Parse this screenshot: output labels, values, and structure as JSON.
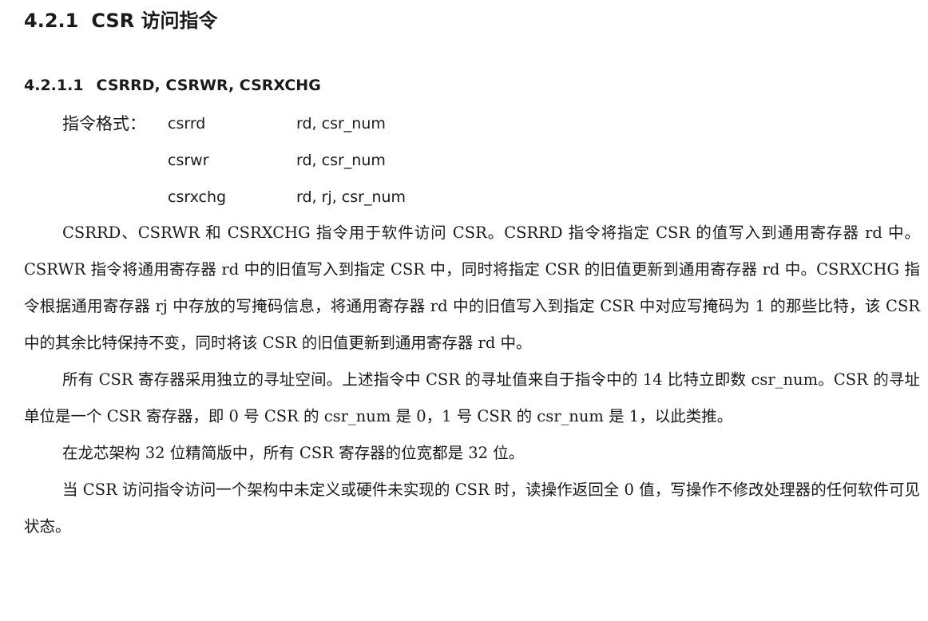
{
  "section": {
    "number": "4.2.1",
    "title": "CSR 访问指令"
  },
  "subsection": {
    "number": "4.2.1.1",
    "title": "CSRRD, CSRWR, CSRXCHG"
  },
  "instruction_format": {
    "label": "指令格式：",
    "rows": [
      {
        "mnemonic": "csrrd",
        "operands": "rd,  csr_num"
      },
      {
        "mnemonic": "csrwr",
        "operands": "rd,  csr_num"
      },
      {
        "mnemonic": "csrxchg",
        "operands": "rd,  rj,  csr_num"
      }
    ]
  },
  "paragraphs": [
    "CSRRD、CSRWR 和 CSRXCHG 指令用于软件访问 CSR。CSRRD 指令将指定 CSR 的值写入到通用寄存器 rd 中。CSRWR 指令将通用寄存器 rd 中的旧值写入到指定 CSR 中，同时将指定 CSR 的旧值更新到通用寄存器 rd 中。CSRXCHG 指令根据通用寄存器 rj 中存放的写掩码信息，将通用寄存器 rd 中的旧值写入到指定 CSR 中对应写掩码为 1 的那些比特，该 CSR 中的其余比特保持不变，同时将该 CSR 的旧值更新到通用寄存器 rd 中。",
    "所有 CSR 寄存器采用独立的寻址空间。上述指令中 CSR 的寻址值来自于指令中的 14 比特立即数 csr_num。CSR 的寻址单位是一个 CSR 寄存器，即 0 号 CSR 的 csr_num 是 0，1 号 CSR 的 csr_num 是 1，以此类推。",
    "在龙芯架构 32 位精简版中，所有 CSR 寄存器的位宽都是 32 位。",
    "当 CSR 访问指令访问一个架构中未定义或硬件未实现的 CSR 时，读操作返回全 0 值，写操作不修改处理器的任何软件可见状态。"
  ]
}
